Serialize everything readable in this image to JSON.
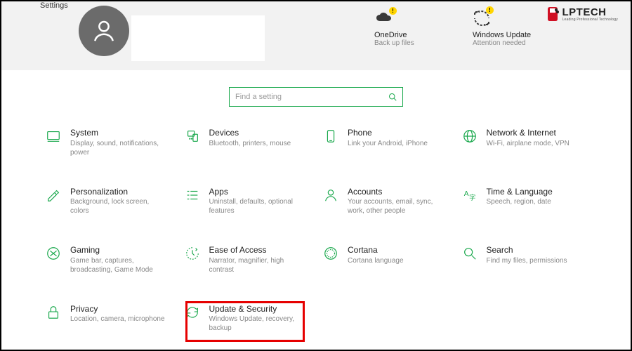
{
  "page_title": "Settings",
  "status": {
    "onedrive": {
      "title": "OneDrive",
      "sub": "Back up files"
    },
    "update": {
      "title": "Windows Update",
      "sub": "Attention needed"
    }
  },
  "logo": {
    "text": "LPTECH",
    "sub": "Leading Professional Technology"
  },
  "search": {
    "placeholder": "Find a setting"
  },
  "categories": [
    {
      "id": "system",
      "title": "System",
      "sub": "Display, sound, notifications, power"
    },
    {
      "id": "devices",
      "title": "Devices",
      "sub": "Bluetooth, printers, mouse"
    },
    {
      "id": "phone",
      "title": "Phone",
      "sub": "Link your Android, iPhone"
    },
    {
      "id": "network",
      "title": "Network & Internet",
      "sub": "Wi-Fi, airplane mode, VPN"
    },
    {
      "id": "personalization",
      "title": "Personalization",
      "sub": "Background, lock screen, colors"
    },
    {
      "id": "apps",
      "title": "Apps",
      "sub": "Uninstall, defaults, optional features"
    },
    {
      "id": "accounts",
      "title": "Accounts",
      "sub": "Your accounts, email, sync, work, other people"
    },
    {
      "id": "time",
      "title": "Time & Language",
      "sub": "Speech, region, date"
    },
    {
      "id": "gaming",
      "title": "Gaming",
      "sub": "Game bar, captures, broadcasting, Game Mode"
    },
    {
      "id": "ease",
      "title": "Ease of Access",
      "sub": "Narrator, magnifier, high contrast"
    },
    {
      "id": "cortana",
      "title": "Cortana",
      "sub": "Cortana language"
    },
    {
      "id": "searchcat",
      "title": "Search",
      "sub": "Find my files, permissions"
    },
    {
      "id": "privacy",
      "title": "Privacy",
      "sub": "Location, camera, microphone"
    },
    {
      "id": "updatesec",
      "title": "Update & Security",
      "sub": "Windows Update, recovery, backup"
    }
  ]
}
